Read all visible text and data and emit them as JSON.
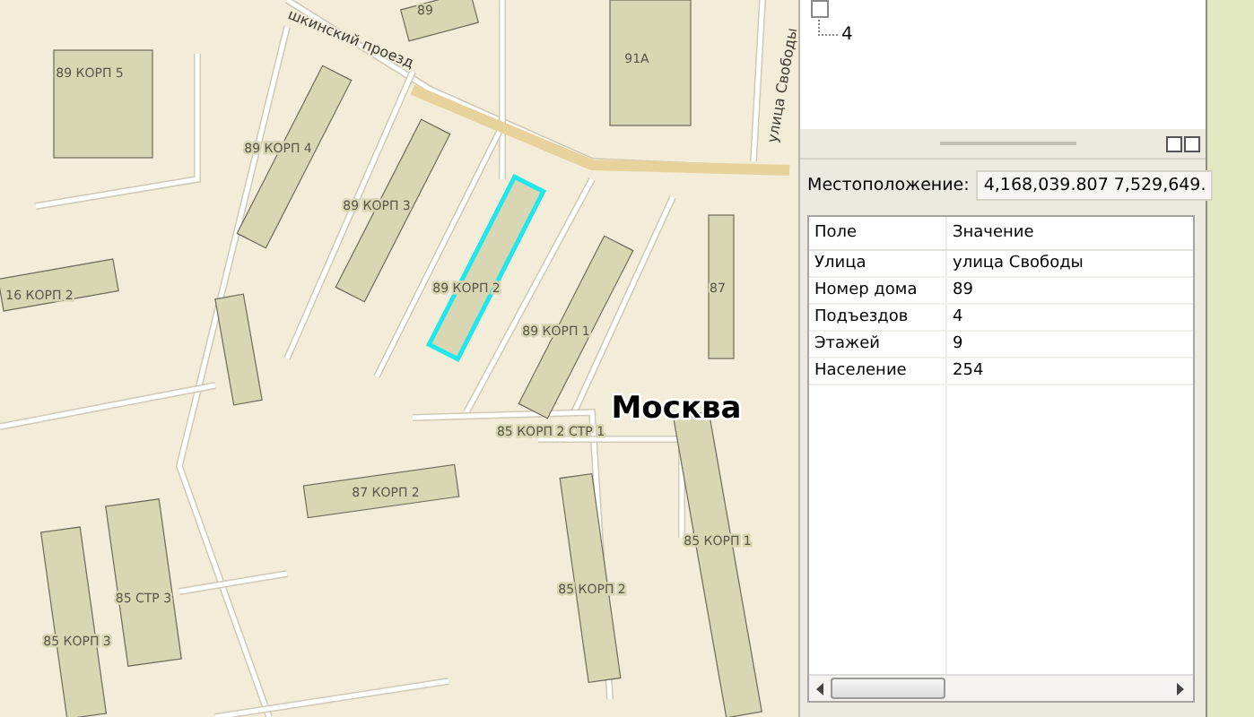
{
  "map": {
    "city_label": "Москва",
    "road_labels": [
      {
        "text": "шкинский проезд",
        "kind": "along"
      },
      {
        "text": "улица Свободы",
        "kind": "vertical"
      }
    ],
    "buildings": [
      {
        "label": "89 КОРП 5",
        "selected": false
      },
      {
        "label": "89",
        "selected": false
      },
      {
        "label": "91А",
        "selected": false
      },
      {
        "label": "89 КОРП 4",
        "selected": false
      },
      {
        "label": "89 КОРП 3",
        "selected": false
      },
      {
        "label": "89 КОРП 2",
        "selected": true
      },
      {
        "label": "89 КОРП 1",
        "selected": false
      },
      {
        "label": "87",
        "selected": false
      },
      {
        "label": "16 КОРП 2",
        "selected": false
      },
      {
        "label": "85 КОРП 2 СТР 1",
        "selected": false
      },
      {
        "label": "87 КОРП 2",
        "selected": false
      },
      {
        "label": "85 КОРП 1",
        "selected": false
      },
      {
        "label": "85 КОРП 2",
        "selected": false
      },
      {
        "label": "85 СТР 3",
        "selected": false
      },
      {
        "label": "85 КОРП 3",
        "selected": false
      }
    ]
  },
  "tree": {
    "layer_checked": false,
    "items": [
      "4"
    ]
  },
  "location": {
    "label": "Местоположение:",
    "value": "4,168,039.807  7,529,649."
  },
  "table": {
    "columns": [
      "Поле",
      "Значение"
    ],
    "rows": [
      [
        "Улица",
        "улица Свободы"
      ],
      [
        "Номер дома",
        "89"
      ],
      [
        "Подъездов",
        "4"
      ],
      [
        "Этажей",
        "9"
      ],
      [
        "Население",
        "254"
      ]
    ]
  }
}
